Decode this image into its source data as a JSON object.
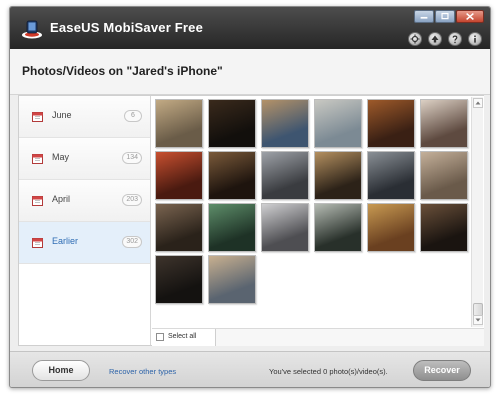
{
  "window": {
    "title": "EaseUS MobiSaver Free",
    "controls": [
      "minimize-icon",
      "maximize-icon",
      "close-icon"
    ],
    "tools": [
      "settings-icon",
      "upgrade-icon",
      "help-icon",
      "info-icon"
    ]
  },
  "header": {
    "device_title": "Photos/Videos on \"Jared's iPhone\""
  },
  "sidebar": {
    "items": [
      {
        "label": "June",
        "count": "6",
        "active": false
      },
      {
        "label": "May",
        "count": "134",
        "active": false
      },
      {
        "label": "April",
        "count": "203",
        "active": false
      },
      {
        "label": "Earlier",
        "count": "302",
        "active": true
      }
    ]
  },
  "grid": {
    "photos": [
      {
        "desc": "outdoor-statue",
        "colors": [
          "#6a5c48",
          "#c2aa84"
        ]
      },
      {
        "desc": "night-scene",
        "colors": [
          "#120f0c",
          "#3a2a1c"
        ]
      },
      {
        "desc": "food-plate",
        "colors": [
          "#3e5570",
          "#b49268"
        ]
      },
      {
        "desc": "beach-landscape",
        "colors": [
          "#7c8a94",
          "#c8c8c2"
        ]
      },
      {
        "desc": "crab-dish",
        "colors": [
          "#3a2014",
          "#9e5a2a"
        ]
      },
      {
        "desc": "window-room",
        "colors": [
          "#5e4a40",
          "#dcd0c4"
        ]
      },
      {
        "desc": "red-light-party",
        "colors": [
          "#4a1a10",
          "#c85030"
        ]
      },
      {
        "desc": "party-night",
        "colors": [
          "#1e140e",
          "#7a5a3a"
        ]
      },
      {
        "desc": "video-frame",
        "colors": [
          "#3a3c40",
          "#9ea2a8"
        ]
      },
      {
        "desc": "sunset-crowd",
        "colors": [
          "#2c2218",
          "#b49060"
        ]
      },
      {
        "desc": "restaurant-window",
        "colors": [
          "#2a2e34",
          "#8a9096"
        ]
      },
      {
        "desc": "dusk-beach",
        "colors": [
          "#6a5a4a",
          "#c4b09a"
        ]
      },
      {
        "desc": "group-photo",
        "colors": [
          "#2a221a",
          "#7a6450"
        ]
      },
      {
        "desc": "green-screen",
        "colors": [
          "#1e3226",
          "#5e8e6a"
        ]
      },
      {
        "desc": "laptop-desk",
        "colors": [
          "#4e4e52",
          "#d0d0d2"
        ]
      },
      {
        "desc": "sign-poster",
        "colors": [
          "#28302a",
          "#b6bcb4"
        ]
      },
      {
        "desc": "food-bowls",
        "colors": [
          "#6a4020",
          "#c89a52"
        ]
      },
      {
        "desc": "dark-crowd",
        "colors": [
          "#1a1410",
          "#6a503a"
        ]
      },
      {
        "desc": "dark-room",
        "colors": [
          "#141210",
          "#3e342c"
        ]
      },
      {
        "desc": "coastal-rock",
        "colors": [
          "#5a6470",
          "#c8b090"
        ]
      }
    ]
  },
  "select_all": {
    "label": "Select all"
  },
  "footer": {
    "home_label": "Home",
    "recover_link": "Recover other types",
    "status": "You've selected 0 photo(s)/video(s).",
    "recover_label": "Recover"
  }
}
